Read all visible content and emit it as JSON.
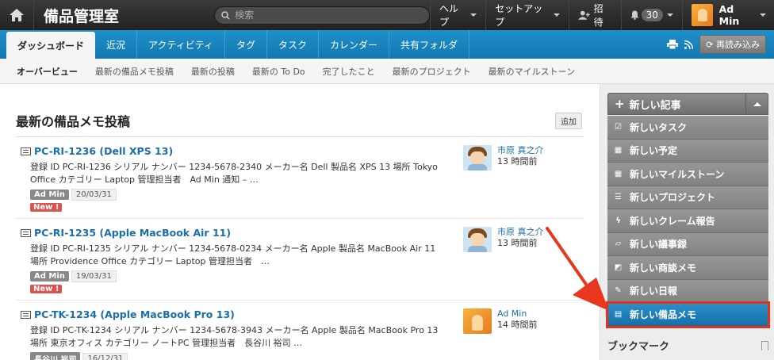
{
  "app": {
    "title": "備品管理室"
  },
  "search": {
    "placeholder": "検索"
  },
  "top_menu": {
    "help": "ヘルプ",
    "setup": "セットアップ",
    "invite": "招待",
    "notifications_count": "30",
    "user_name": "Ad Min"
  },
  "tabs": [
    {
      "label": "ダッシュボード",
      "active": true
    },
    {
      "label": "近況"
    },
    {
      "label": "アクティビティ"
    },
    {
      "label": "タグ"
    },
    {
      "label": "タスク"
    },
    {
      "label": "カレンダー"
    },
    {
      "label": "共有フォルダ"
    }
  ],
  "tab_tools": {
    "reload": "再読み込み"
  },
  "subnav": [
    {
      "label": "オーバービュー",
      "active": true
    },
    {
      "label": "最新の備品メモ投稿"
    },
    {
      "label": "最新の投稿"
    },
    {
      "label": "最新の To Do"
    },
    {
      "label": "完了したこと"
    },
    {
      "label": "最新のプロジェクト"
    },
    {
      "label": "最新のマイルストーン"
    }
  ],
  "section": {
    "title": "最新の備品メモ投稿",
    "add_label": "追加"
  },
  "posts": [
    {
      "title": "PC-RI-1236 (Dell XPS 13)",
      "text": "登録 ID PC-RI-1236 シリアル ナンバー 1234-5678-2340 メーカー名 Dell 製品名 XPS 13 場所 Tokyo Office カテゴリー Laptop 管理担当者　Ad Min 通知 – …",
      "author_tag": "Ad Min",
      "date": "20/03/31",
      "new_label": "New !",
      "poster": "市原 真之介",
      "time": "13 時間前"
    },
    {
      "title": "PC-RI-1235 (Apple MacBook Air 11)",
      "text": "登録 ID PC-RI-1235 シリアル ナンバー 1234-5678-0234 メーカー名 Apple 製品名 MacBook Air 11 場所 Providence Office カテゴリー Laptop 管理担当者　…",
      "author_tag": "Ad Min",
      "date": "19/03/31",
      "new_label": "New !",
      "poster": "市原 真之介",
      "time": "13 時間前"
    },
    {
      "title": "PC-TK-1234 (Apple MacBook Pro 13)",
      "text": "登録 ID PC-TK-1234 シリアル ナンバー 1234-5678-3943 メーカー名 Apple 製品名 MacBook Pro 13 場所 東京オフィス カテゴリー ノートPC 管理担当者　長谷川 裕司 …",
      "author_tag": "長谷川 裕司",
      "date": "16/12/31",
      "poster": "Ad Min",
      "time": "14 時間前"
    }
  ],
  "sidebar": {
    "header": "新しい記事",
    "items": [
      {
        "label": "新しいタスク",
        "icon": "check-icon"
      },
      {
        "label": "新しい予定",
        "icon": "calendar-icon"
      },
      {
        "label": "新しいマイルストーン",
        "icon": "calendar-icon"
      },
      {
        "label": "新しいプロジェクト",
        "icon": "project-icon"
      },
      {
        "label": "新しいクレーム報告",
        "icon": "lightning-icon"
      },
      {
        "label": "新しい議事録",
        "icon": "book-icon"
      },
      {
        "label": "新しい商談メモ",
        "icon": "note-icon"
      },
      {
        "label": "新しい日報",
        "icon": "pencil-icon"
      },
      {
        "label": "新しい備品メモ",
        "icon": "list-icon",
        "highlighted": true
      }
    ],
    "bookmark": "ブックマーク"
  },
  "colors": {
    "accent": "#1f8fc9",
    "highlight_border": "#e2341d",
    "arrow": "#e8361f"
  }
}
